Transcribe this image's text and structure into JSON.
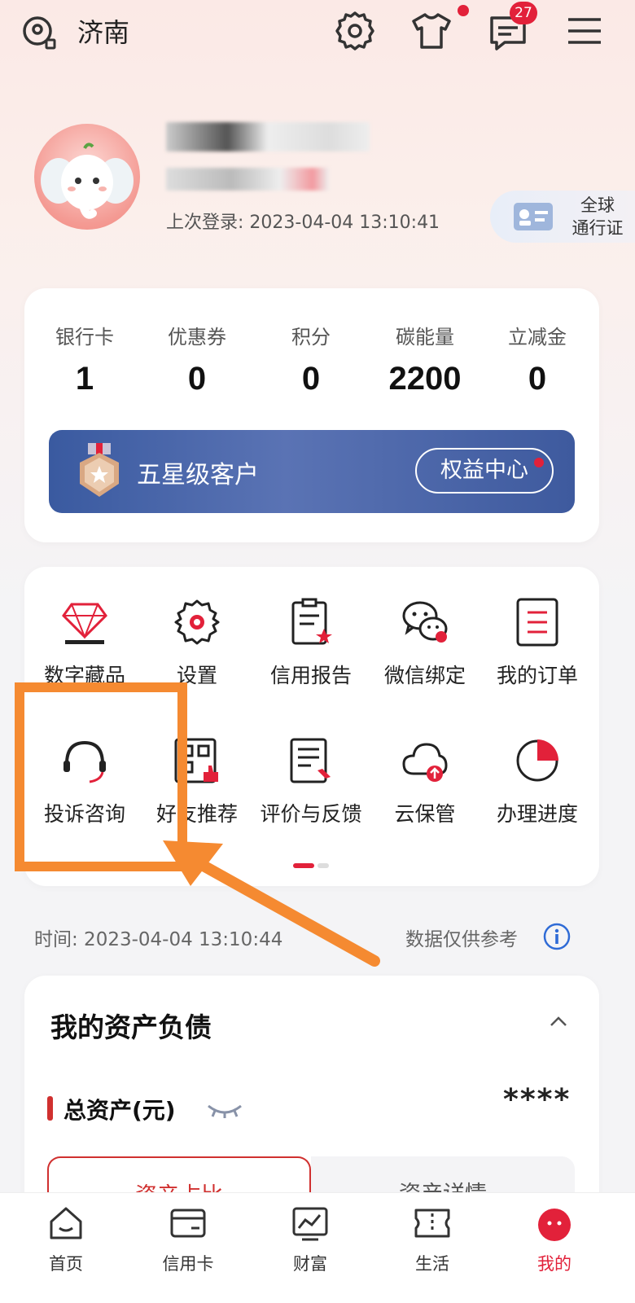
{
  "header": {
    "city": "济南",
    "message_badge": "27",
    "icons": [
      "location-icon",
      "settings-icon",
      "outfit-icon",
      "message-icon",
      "menu-icon"
    ]
  },
  "profile": {
    "last_login": "上次登录: 2023-04-04 13:10:41",
    "passport_line1": "全球",
    "passport_line2": "通行证"
  },
  "stats": [
    {
      "label": "银行卡",
      "value": "1"
    },
    {
      "label": "优惠券",
      "value": "0"
    },
    {
      "label": "积分",
      "value": "0"
    },
    {
      "label": "碳能量",
      "value": "2200"
    },
    {
      "label": "立减金",
      "value": "0"
    }
  ],
  "vip": {
    "level": "五星级客户",
    "button": "权益中心"
  },
  "grid": [
    {
      "label": "数字藏品",
      "icon": "gem-icon"
    },
    {
      "label": "设置",
      "icon": "gear-icon"
    },
    {
      "label": "信用报告",
      "icon": "report-icon"
    },
    {
      "label": "微信绑定",
      "icon": "wechat-icon"
    },
    {
      "label": "我的订单",
      "icon": "order-icon"
    },
    {
      "label": "投诉咨询",
      "icon": "headset-icon"
    },
    {
      "label": "好友推荐",
      "icon": "qr-like-icon"
    },
    {
      "label": "评价与反馈",
      "icon": "feedback-icon"
    },
    {
      "label": "云保管",
      "icon": "cloud-icon"
    },
    {
      "label": "办理进度",
      "icon": "progress-icon"
    }
  ],
  "info": {
    "time": "时间: 2023-04-04 13:10:44",
    "reference": "数据仅供参考"
  },
  "assets": {
    "title": "我的资产负债",
    "total_label": "总资产(元)",
    "total_value": "****",
    "tab_left": "资产占比",
    "tab_right": "资产详情"
  },
  "nav": [
    {
      "label": "首页",
      "icon": "home-icon"
    },
    {
      "label": "信用卡",
      "icon": "card-icon"
    },
    {
      "label": "财富",
      "icon": "chart-icon"
    },
    {
      "label": "生活",
      "icon": "ticket-icon"
    },
    {
      "label": "我的",
      "icon": "me-icon"
    }
  ],
  "colors": {
    "accent_red": "#e2213a",
    "vip_blue": "#3a5aa0",
    "annotation_orange": "#f58a31"
  }
}
